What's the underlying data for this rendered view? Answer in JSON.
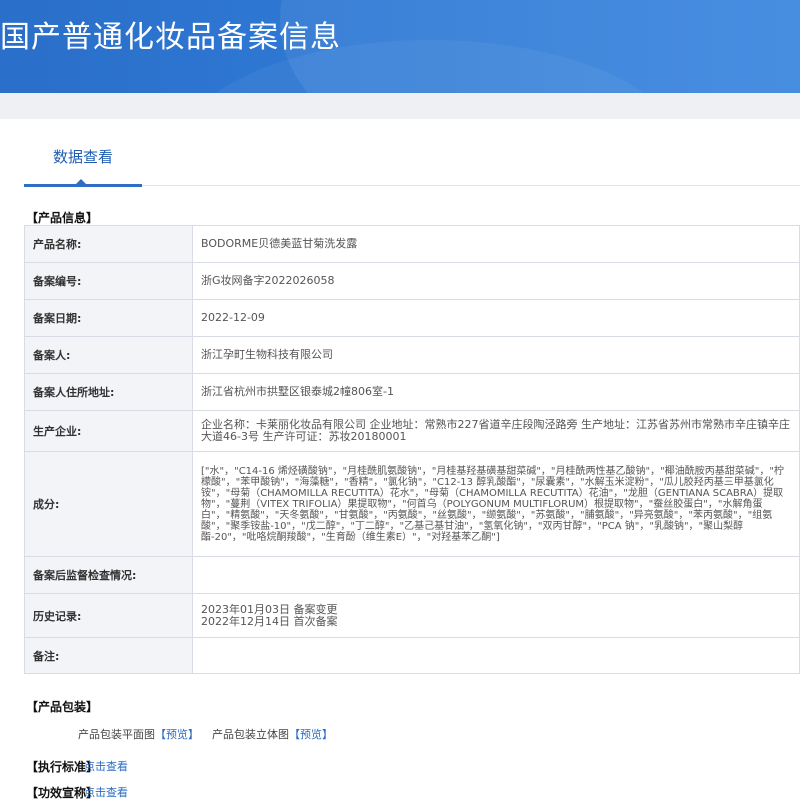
{
  "header": {
    "title": "国产普通化妆品备案信息"
  },
  "tabs": [
    {
      "label": "数据查看"
    }
  ],
  "product_info": {
    "section_title": "【产品信息】",
    "rows": [
      {
        "label": "产品名称:",
        "value": "BODORME贝德美蓝甘菊洗发露"
      },
      {
        "label": "备案编号:",
        "value": "浙G妆网备字2022026058"
      },
      {
        "label": "备案日期:",
        "value": "2022-12-09"
      },
      {
        "label": "备案人:",
        "value": "浙江孕町生物科技有限公司"
      },
      {
        "label": "备案人住所地址:",
        "value": "浙江省杭州市拱墅区银泰城2幢806室-1"
      },
      {
        "label": "生产企业:",
        "value": "企业名称：卡莱丽化妆品有限公司 企业地址：常熟市227省道辛庄段陶泾路旁 生产地址：江苏省苏州市常熟市辛庄镇辛庄大道46-3号 生产许可证：苏妆20180001"
      },
      {
        "label": "成分:",
        "value": "[\"水\"，\"C14-16 烯烃磺酸钠\"，\"月桂酰肌氨酸钠\"，\"月桂基羟基磺基甜菜碱\"，\"月桂酰两性基乙酸钠\"，\"椰油酰胺丙基甜菜碱\"，\"柠檬酸\"，\"苯甲酸钠\"，\"海藻糖\"，\"香精\"，\"氯化钠\"，\"C12-13 醇乳酸酯\"，\"尿囊素\"，\"水解玉米淀粉\"，\"瓜儿胶羟丙基三甲基氯化铵\"，\"母菊（CHAMOMILLA RECUTITA）花水\"，\"母菊（CHAMOMILLA RECUTITA）花油\"，\"龙胆（GENTIANA SCABRA）提取物\"，\"蔓荆（VITEX TRIFOLIA）果提取物\"，\"何首乌（POLYGONUM MULTIFLORUM）根提取物\"，\"蚕丝胶蛋白\"，\"水解角蛋白\"，\"精氨酸\"，\"天冬氨酸\"，\"甘氨酸\"，\"丙氨酸\"，\"丝氨酸\"，\"缬氨酸\"，\"苏氨酸\"，\"脯氨酸\"，\"异亮氨酸\"，\"苯丙氨酸\"，\"组氨酸\"，\"聚季铵盐-10\"，\"戊二醇\"，\"丁二醇\"，\"乙基己基甘油\"，\"氢氧化钠\"，\"双丙甘醇\"，\"PCA 钠\"，\"乳酸钠\"，\"聚山梨醇酯-20\"，\"吡咯烷酮羧酸\"，\"生育酚（维生素E）\"，\"对羟基苯乙酮\"]"
      },
      {
        "label": "备案后监督检查情况:",
        "value": ""
      },
      {
        "label": "历史记录:",
        "value_lines": [
          "2023年01月03日 备案变更",
          "2022年12月14日 首次备案"
        ]
      },
      {
        "label": "备注:",
        "value": ""
      }
    ]
  },
  "packaging": {
    "section_title": "【产品包装】",
    "items": [
      {
        "label": "产品包装平面图",
        "link_text": "【预览】"
      },
      {
        "label": "产品包装立体图",
        "link_text": "【预览】"
      }
    ]
  },
  "standard": {
    "section_title": "【执行标准】",
    "link_text": "点击查看"
  },
  "efficacy": {
    "section_title": "【功效宣称】",
    "link_text": "点击查看"
  }
}
